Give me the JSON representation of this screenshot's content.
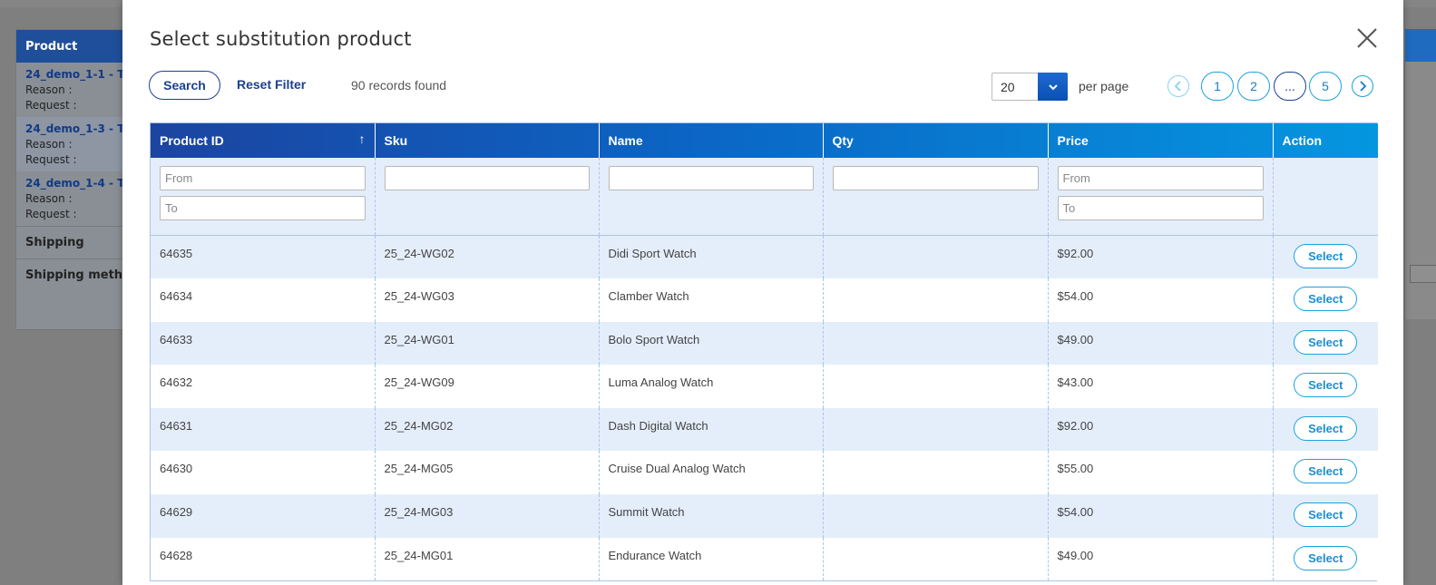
{
  "background": {
    "panel_header": "Product",
    "items": [
      {
        "link": "24_demo_1-1 - T",
        "reason": "Reason :",
        "request": "Request :"
      },
      {
        "link": "24_demo_1-3 - T",
        "reason": "Reason :",
        "request": "Request :"
      },
      {
        "link": "24_demo_1-4 - T",
        "reason": "Reason :",
        "request": "Request :"
      }
    ],
    "shipping": "Shipping",
    "shipping_method": "Shipping metho"
  },
  "modal": {
    "title": "Select substitution product",
    "search_label": "Search",
    "reset_label": "Reset Filter",
    "records_found": "90 records found",
    "per_page_value": "20",
    "per_page_label": "per page",
    "pages": [
      "1",
      "2",
      "...",
      "5"
    ],
    "current_page": "..."
  },
  "table": {
    "columns": [
      "Product ID",
      "Sku",
      "Name",
      "Qty",
      "Price",
      "Action"
    ],
    "filters": {
      "product_from": "From",
      "product_to": "To",
      "price_from": "From",
      "price_to": "To"
    },
    "select_label": "Select",
    "rows": [
      {
        "id": "64635",
        "sku": "25_24-WG02",
        "name": "Didi Sport Watch",
        "qty": "",
        "price": "$92.00"
      },
      {
        "id": "64634",
        "sku": "25_24-WG03",
        "name": "Clamber Watch",
        "qty": "",
        "price": "$54.00"
      },
      {
        "id": "64633",
        "sku": "25_24-WG01",
        "name": "Bolo Sport Watch",
        "qty": "",
        "price": "$49.00"
      },
      {
        "id": "64632",
        "sku": "25_24-WG09",
        "name": "Luma Analog Watch",
        "qty": "",
        "price": "$43.00"
      },
      {
        "id": "64631",
        "sku": "25_24-MG02",
        "name": "Dash Digital Watch",
        "qty": "",
        "price": "$92.00"
      },
      {
        "id": "64630",
        "sku": "25_24-MG05",
        "name": "Cruise Dual Analog Watch",
        "qty": "",
        "price": "$55.00"
      },
      {
        "id": "64629",
        "sku": "25_24-MG03",
        "name": "Summit Watch",
        "qty": "",
        "price": "$54.00"
      },
      {
        "id": "64628",
        "sku": "25_24-MG01",
        "name": "Endurance Watch",
        "qty": "",
        "price": "$49.00"
      }
    ]
  },
  "colors": {
    "primary": "#1d3f8e",
    "accent": "#1aa2dd",
    "header_gradient_start": "#1c44a1",
    "header_gradient_end": "#0596e0",
    "row_alt": "#e4eefb"
  }
}
